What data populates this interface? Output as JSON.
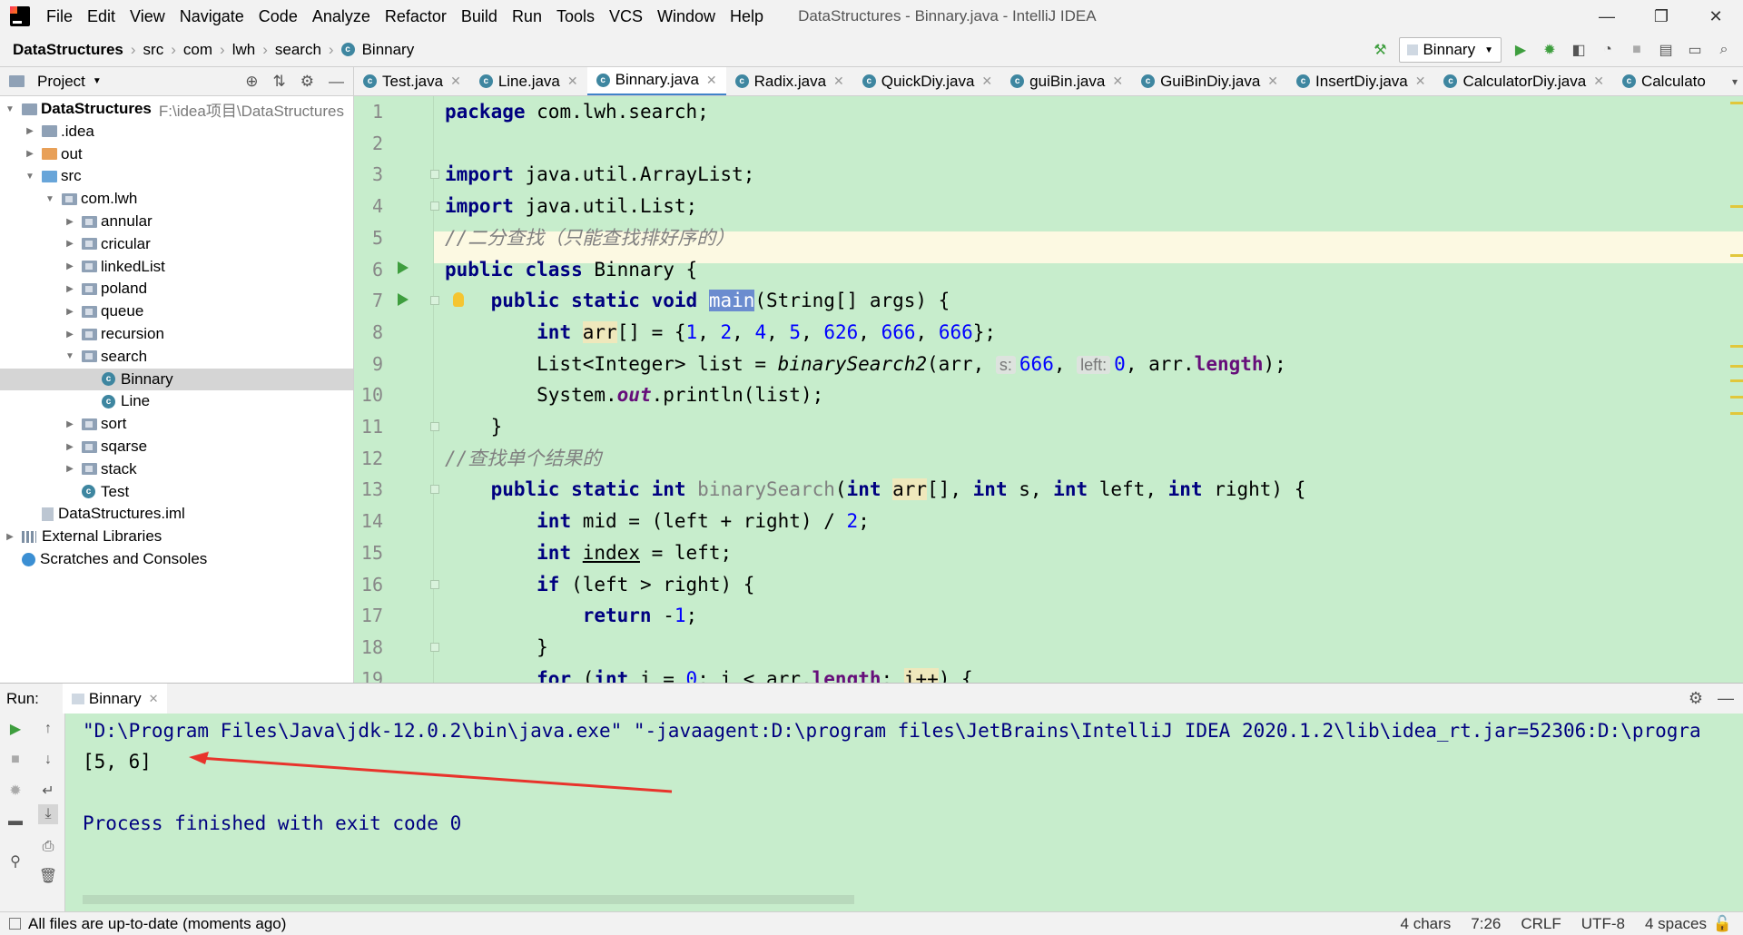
{
  "menubar": {
    "items": [
      "File",
      "Edit",
      "View",
      "Navigate",
      "Code",
      "Analyze",
      "Refactor",
      "Build",
      "Run",
      "Tools",
      "VCS",
      "Window",
      "Help"
    ],
    "window_title": "DataStructures - Binnary.java - IntelliJ IDEA",
    "window_controls": [
      "—",
      "❐",
      "✕"
    ]
  },
  "breadcrumb": [
    "DataStructures",
    "src",
    "com",
    "lwh",
    "search",
    "Binnary"
  ],
  "run_config": "Binnary",
  "project_panel": {
    "title": "Project",
    "tree": [
      {
        "label": "DataStructures",
        "extra": "F:\\idea项目\\DataStructures",
        "depth": 0,
        "arrow": "down",
        "icon": "module",
        "bold": true
      },
      {
        "label": ".idea",
        "depth": 1,
        "arrow": "right",
        "icon": "folder"
      },
      {
        "label": "out",
        "depth": 1,
        "arrow": "right",
        "icon": "folder-orange"
      },
      {
        "label": "src",
        "depth": 1,
        "arrow": "down",
        "icon": "folder-blue"
      },
      {
        "label": "com.lwh",
        "depth": 2,
        "arrow": "down",
        "icon": "package"
      },
      {
        "label": "annular",
        "depth": 3,
        "arrow": "right",
        "icon": "package"
      },
      {
        "label": "cricular",
        "depth": 3,
        "arrow": "right",
        "icon": "package"
      },
      {
        "label": "linkedList",
        "depth": 3,
        "arrow": "right",
        "icon": "package"
      },
      {
        "label": "poland",
        "depth": 3,
        "arrow": "right",
        "icon": "package"
      },
      {
        "label": "queue",
        "depth": 3,
        "arrow": "right",
        "icon": "package"
      },
      {
        "label": "recursion",
        "depth": 3,
        "arrow": "right",
        "icon": "package"
      },
      {
        "label": "search",
        "depth": 3,
        "arrow": "down",
        "icon": "package"
      },
      {
        "label": "Binnary",
        "depth": 4,
        "arrow": "",
        "icon": "class",
        "selected": true
      },
      {
        "label": "Line",
        "depth": 4,
        "arrow": "",
        "icon": "class"
      },
      {
        "label": "sort",
        "depth": 3,
        "arrow": "right",
        "icon": "package"
      },
      {
        "label": "sqarse",
        "depth": 3,
        "arrow": "right",
        "icon": "package"
      },
      {
        "label": "stack",
        "depth": 3,
        "arrow": "right",
        "icon": "package"
      },
      {
        "label": "Test",
        "depth": 3,
        "arrow": "",
        "icon": "class"
      },
      {
        "label": "DataStructures.iml",
        "depth": 1,
        "arrow": "",
        "icon": "file"
      },
      {
        "label": "External Libraries",
        "depth": 0,
        "arrow": "right",
        "icon": "lib"
      },
      {
        "label": "Scratches and Consoles",
        "depth": 0,
        "arrow": "",
        "icon": "scratch"
      }
    ]
  },
  "editor_tabs": [
    "Test.java",
    "Line.java",
    "Binnary.java",
    "Radix.java",
    "QuickDiy.java",
    "guiBin.java",
    "GuiBinDiy.java",
    "InsertDiy.java",
    "CalculatorDiy.java",
    "Calculato"
  ],
  "active_tab": "Binnary.java",
  "code_lines": [
    "1",
    "2",
    "3",
    "4",
    "5",
    "6",
    "7",
    "8",
    "9",
    "10",
    "11",
    "12",
    "13",
    "14",
    "15",
    "16",
    "17",
    "18",
    "19"
  ],
  "run_panel": {
    "label": "Run:",
    "tab": "Binnary",
    "output": [
      "\"D:\\Program Files\\Java\\jdk-12.0.2\\bin\\java.exe\" \"-javaagent:D:\\program files\\JetBrains\\IntelliJ IDEA 2020.1.2\\lib\\idea_rt.jar=52306:D:\\progra",
      "[5, 6]",
      "",
      "Process finished with exit code 0"
    ]
  },
  "statusbar": {
    "message": "All files are up-to-date (moments ago)",
    "chars": "4 chars",
    "position": "7:26",
    "line_sep": "CRLF",
    "encoding": "UTF-8",
    "indent": "4 spaces"
  },
  "colors": {
    "editor_bg": "#c7edcc",
    "keyword": "#000080",
    "number": "#0000ff",
    "annotation_arrow": "#e8332b"
  }
}
